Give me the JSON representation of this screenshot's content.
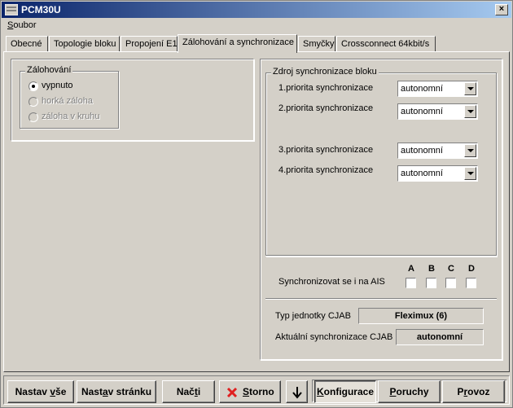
{
  "window": {
    "title": "PCM30U",
    "close": "×"
  },
  "menu": {
    "soubor_first": "S",
    "soubor_rest": "oubor"
  },
  "tabs": [
    {
      "label": "Obecné"
    },
    {
      "label": "Topologie bloku"
    },
    {
      "label": "Propojení E1"
    },
    {
      "label": "Zálohování a synchronizace",
      "active": true
    },
    {
      "label": "Smyčky"
    },
    {
      "label": "Crossconnect 64kbit/s"
    }
  ],
  "backup": {
    "legend": "Zálohování",
    "options": [
      {
        "label": "vypnuto",
        "selected": true,
        "enabled": true
      },
      {
        "label": "horká záloha",
        "selected": false,
        "enabled": false
      },
      {
        "label": "záloha v kruhu",
        "selected": false,
        "enabled": false
      }
    ]
  },
  "sync": {
    "legend": "Zdroj synchronizace bloku",
    "priorities": [
      {
        "label": "1.priorita synchronizace",
        "value": "autonomní"
      },
      {
        "label": "2.priorita synchronizace",
        "value": "autonomní"
      },
      {
        "label": "3.priorita synchronizace",
        "value": "autonomní"
      },
      {
        "label": "4.priorita synchronizace",
        "value": "autonomní"
      }
    ],
    "ais_label": "Synchronizovat se i na AIS",
    "ais_columns": [
      "A",
      "B",
      "C",
      "D"
    ],
    "cjab_type_label": "Typ jednotky CJAB",
    "cjab_type_value": "Fleximux (6)",
    "cjab_sync_label": "Aktuální synchronizace CJAB",
    "cjab_sync_value": "autonomní"
  },
  "buttons": {
    "set_all_a": "Nastav ",
    "set_all_b": "v",
    "set_all_c": "še",
    "set_page_a": "Nast",
    "set_page_b": "a",
    "set_page_c": "v stránku",
    "load_a": "Nač",
    "load_b": "t",
    "load_c": "i",
    "cancel_a": "",
    "cancel_b": "S",
    "cancel_c": "torno",
    "config_a": "",
    "config_b": "K",
    "config_c": "onfigurace",
    "faults_a": "",
    "faults_b": "P",
    "faults_c": "oruchy",
    "oper_a": "P",
    "oper_b": "r",
    "oper_c": "ovoz"
  },
  "colors": {
    "titlebar_start": "#0a246a",
    "titlebar_end": "#a6caf0",
    "cancel_icon": "#e02020"
  }
}
